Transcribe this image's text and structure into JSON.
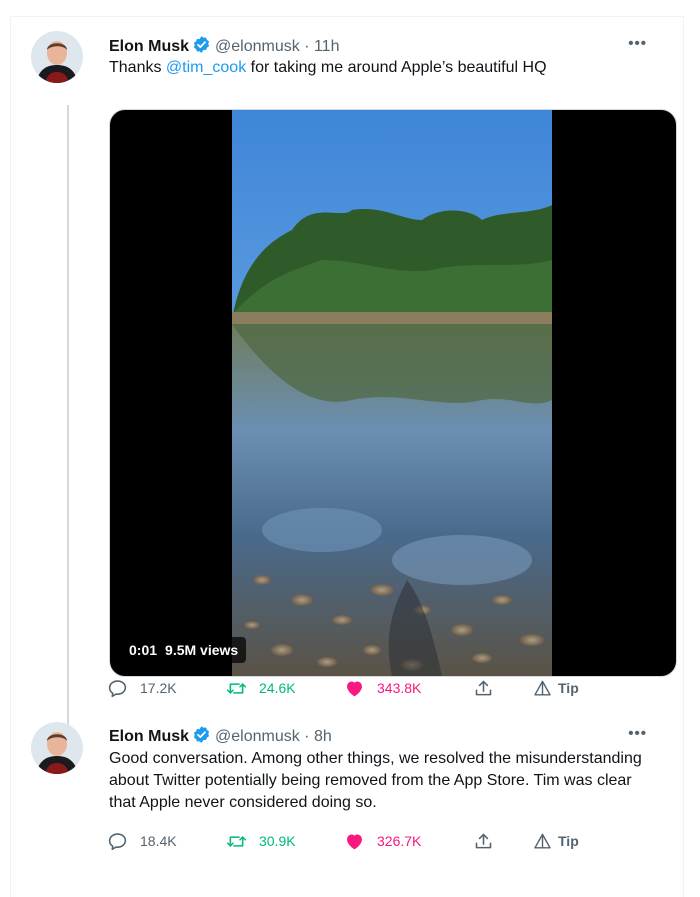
{
  "tweets": [
    {
      "author_name": "Elon Musk",
      "handle": "@elonmusk",
      "time": "11h",
      "text_before": "Thanks ",
      "mention": "@tim_cook",
      "text_after": " for taking me around Apple’s beautiful HQ",
      "media": {
        "time": "0:01",
        "views": "9.5M views"
      },
      "replies": "17.2K",
      "retweets": "24.6K",
      "likes": "343.8K",
      "tip": "Tip"
    },
    {
      "author_name": "Elon Musk",
      "handle": "@elonmusk",
      "time": "8h",
      "text_lines": [
        "Good conversation. Among other things, we resolved the misunderstanding",
        "about Twitter potentially being removed from the App Store. Tim was clear",
        "that Apple never considered doing so."
      ],
      "replies": "18.4K",
      "retweets": "30.9K",
      "likes": "326.7K",
      "tip": "Tip"
    }
  ],
  "colors": {
    "accent": "#1d9bf0",
    "retweet": "#00ba7c",
    "like": "#f91880",
    "muted": "#536471"
  },
  "icons": [
    "verified-badge-icon",
    "more-icon",
    "reply-icon",
    "retweet-icon",
    "like-icon",
    "share-icon",
    "tip-icon"
  ]
}
